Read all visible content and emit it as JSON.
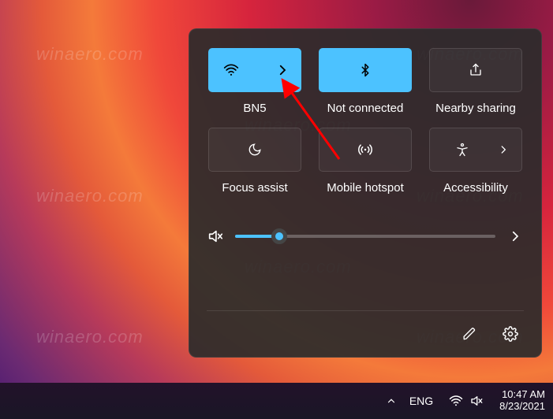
{
  "panel": {
    "tiles": [
      {
        "label": "BN5",
        "active": true,
        "icon": "wifi",
        "has_chevron": true
      },
      {
        "label": "Not connected",
        "active": true,
        "icon": "bluetooth",
        "has_chevron": false
      },
      {
        "label": "Nearby sharing",
        "active": false,
        "icon": "share",
        "has_chevron": false
      },
      {
        "label": "Focus assist",
        "active": false,
        "icon": "moon",
        "has_chevron": false
      },
      {
        "label": "Mobile hotspot",
        "active": false,
        "icon": "hotspot",
        "has_chevron": false
      },
      {
        "label": "Accessibility",
        "active": false,
        "icon": "accessibility",
        "has_chevron": true
      }
    ],
    "volume": {
      "percent": 17,
      "muted": true
    }
  },
  "taskbar": {
    "language": "ENG",
    "time": "10:47 AM",
    "date": "8/23/2021",
    "wifi_connected": true,
    "sound_muted": true
  },
  "watermark_text": "winaero.com",
  "accent": "#4cc2ff"
}
